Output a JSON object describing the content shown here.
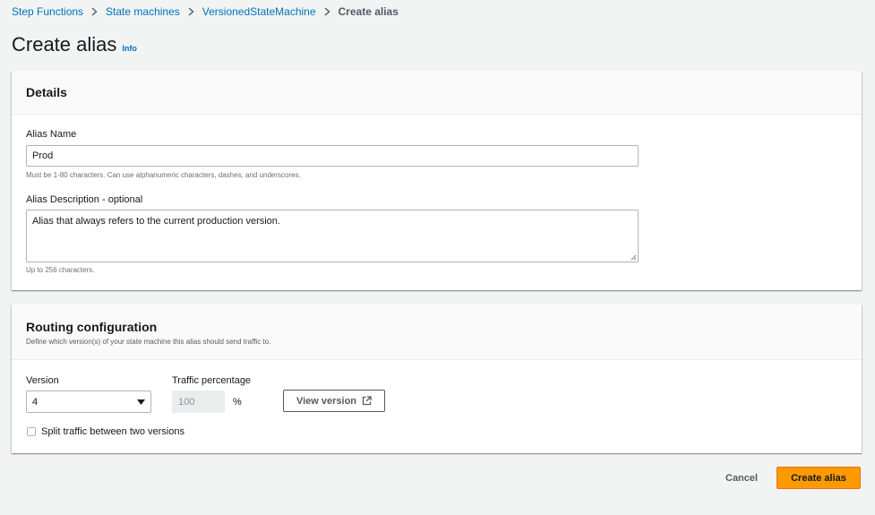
{
  "breadcrumb": {
    "items": [
      "Step Functions",
      "State machines",
      "VersionedStateMachine"
    ],
    "current": "Create alias"
  },
  "page": {
    "title": "Create alias",
    "info_label": "Info"
  },
  "details": {
    "heading": "Details",
    "alias_name_label": "Alias Name",
    "alias_name_value": "Prod",
    "alias_name_hint": "Must be 1-80 characters. Can use alphanumeric characters, dashes, and underscores.",
    "description_label": "Alias Description - optional",
    "description_value": "Alias that always refers to the current production version.",
    "description_hint": "Up to 256 characters."
  },
  "routing": {
    "heading": "Routing configuration",
    "description": "Define which version(s) of your state machine this alias should send traffic to.",
    "version_label": "Version",
    "version_value": "4",
    "traffic_label": "Traffic percentage",
    "traffic_value": "100",
    "percent_sign": "%",
    "view_version_label": "View version",
    "split_label": "Split traffic between two versions"
  },
  "footer": {
    "cancel_label": "Cancel",
    "create_label": "Create alias"
  },
  "colors": {
    "link": "#0073bb",
    "primary": "#ff9900",
    "background": "#f2f3f3"
  }
}
